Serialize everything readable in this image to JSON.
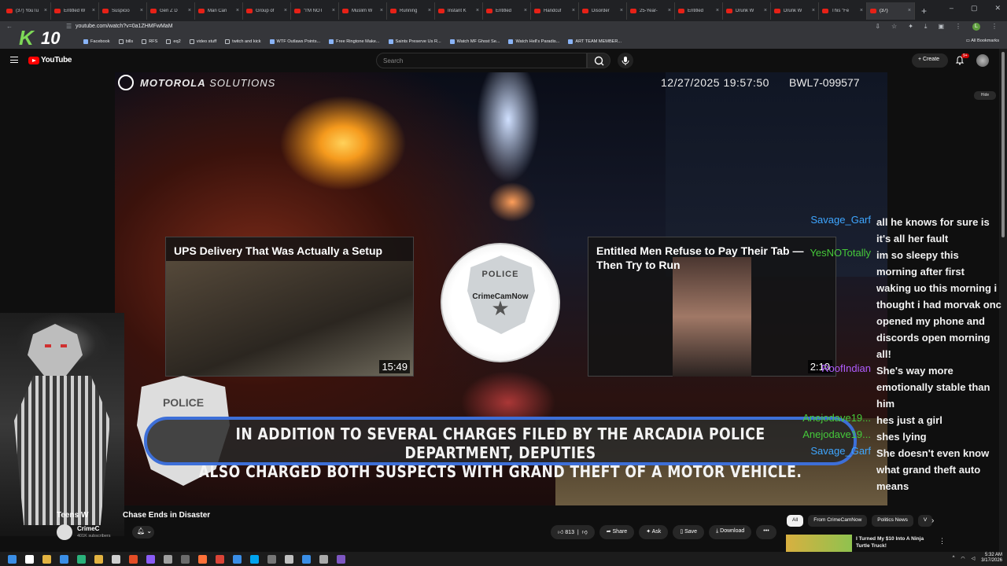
{
  "browser": {
    "tabs": [
      {
        "label": "(37) YouTu"
      },
      {
        "label": "Entitled W"
      },
      {
        "label": "Suspicio"
      },
      {
        "label": "Gen Z D"
      },
      {
        "label": "Man Can"
      },
      {
        "label": "Group of"
      },
      {
        "label": "\"I'M NOT"
      },
      {
        "label": "Muslim W"
      },
      {
        "label": "Running"
      },
      {
        "label": "Instant K"
      },
      {
        "label": "Entitled"
      },
      {
        "label": "Handcuf"
      },
      {
        "label": "Disorder"
      },
      {
        "label": "25-Year-"
      },
      {
        "label": "Entitled"
      },
      {
        "label": "Drunk W"
      },
      {
        "label": "Drunk W"
      },
      {
        "label": "This \"Fe"
      },
      {
        "label": "(37)"
      }
    ],
    "new_tab": "+",
    "window_controls": [
      "–",
      "▢",
      "✕"
    ],
    "url": "youtube.com/watch?v=0a1ZHMFwMaM",
    "bookmarks": [
      {
        "label": "Facebook",
        "icon": "facebook-icon"
      },
      {
        "label": "bills",
        "icon": "folder-icon"
      },
      {
        "label": "RFS",
        "icon": "folder-icon"
      },
      {
        "label": "eq2",
        "icon": "folder-icon"
      },
      {
        "label": "video stuff",
        "icon": "folder-icon"
      },
      {
        "label": "twitch and kick",
        "icon": "folder-icon"
      },
      {
        "label": "WTF Outlaws Points...",
        "icon": "site-icon"
      },
      {
        "label": "Free Ringtone Make...",
        "icon": "site-icon"
      },
      {
        "label": "Saints Preserve Us R...",
        "icon": "site-icon"
      },
      {
        "label": "Watch MF Ghost Se...",
        "icon": "site-icon"
      },
      {
        "label": "Watch Hell's Paradis...",
        "icon": "site-icon"
      },
      {
        "label": "ART TEAM MEMBER...",
        "icon": "site-icon"
      }
    ],
    "all_bookmarks": "All Bookmarks"
  },
  "youtube": {
    "logo_text": "YouTube",
    "search_placeholder": "Search",
    "create_label": "+ Create",
    "notification_count": "9+"
  },
  "overlay_logo": {
    "k": "K",
    "num": "10"
  },
  "video": {
    "brand_bold": "MOTOROLA",
    "brand_light": "SOLUTIONS",
    "timestamp": "12/27/2025 19:57:50",
    "camera_id": "BWL7-099577",
    "hide_label": "Hide",
    "caption_line1": "IN ADDITION TO SEVERAL CHARGES FILED BY THE ARCADIA POLICE DEPARTMENT, DEPUTIES",
    "caption_line2": "ALSO CHARGED BOTH SUSPECTS WITH GRAND THEFT OF A MOTOR VEHICLE.",
    "left_badge_text": "POLICE",
    "end_cards": [
      {
        "title": "UPS Delivery That Was Actually a Setup",
        "duration": "15:49"
      },
      {
        "title": "Entitled Men Refuse to Pay Their Tab — Then Try to Run",
        "duration": "2:10"
      }
    ],
    "channel_badge": {
      "top": "POLICE",
      "name": "CrimeCamNow"
    }
  },
  "chat": [
    {
      "user": "Savage_Garf",
      "color": "#3ea6ff",
      "lines": [
        "all he knows for sure is",
        "it's all her fault"
      ]
    },
    {
      "user": "YesNOTotally",
      "color": "#45c93a",
      "lines": [
        "im so sleepy this",
        "morning after first",
        "waking uo this morning i",
        "thought i had morvak onc",
        "opened my phone and",
        "discords open morning",
        "all!"
      ]
    },
    {
      "user": "RoofIndian",
      "color": "#b05cff",
      "lines": [
        "She's way more",
        "emotionally stable than",
        "him"
      ]
    },
    {
      "user": "Anejodave19...",
      "color": "#45c93a",
      "lines": [
        "hes just a girl"
      ]
    },
    {
      "user": "Anejodave19...",
      "color": "#45c93a",
      "lines": [
        "shes lying"
      ]
    },
    {
      "user": "Savage_Garf",
      "color": "#3ea6ff",
      "lines": [
        "She doesn't even know",
        "what grand theft auto",
        "means"
      ]
    }
  ],
  "below_video": {
    "title_part1": "Teens W",
    "title_part2": "Chase Ends in Disaster",
    "channel": "CrimeC",
    "subscribers": "401K subscribers",
    "likes": "813",
    "share": "Share",
    "ask": "Ask",
    "save": "Save",
    "download": "Download",
    "more": "•••"
  },
  "sidebar_chips": [
    "All",
    "From CrimeCamNow",
    "Politics News",
    "V"
  ],
  "suggestion": {
    "title": "I Turned My $10 Into A Ninja Turtle Truck!"
  },
  "taskbar": {
    "time": "5:32 AM",
    "date": "3/17/2026",
    "icons": [
      "#3a8ee6",
      "#ffffff",
      "#e3b341",
      "#3a8ee6",
      "#2ab27b",
      "#e3b341",
      "#cfcfcf",
      "#e44d26",
      "#8a5cf6",
      "#a0a0a0",
      "#6b6b6b",
      "#ff7139",
      "#db4437",
      "#3a8ee6",
      "#00a4ef",
      "#777777",
      "#c0c0c0",
      "#3a8ee6",
      "#aaaaaa",
      "#7e57c2"
    ]
  }
}
